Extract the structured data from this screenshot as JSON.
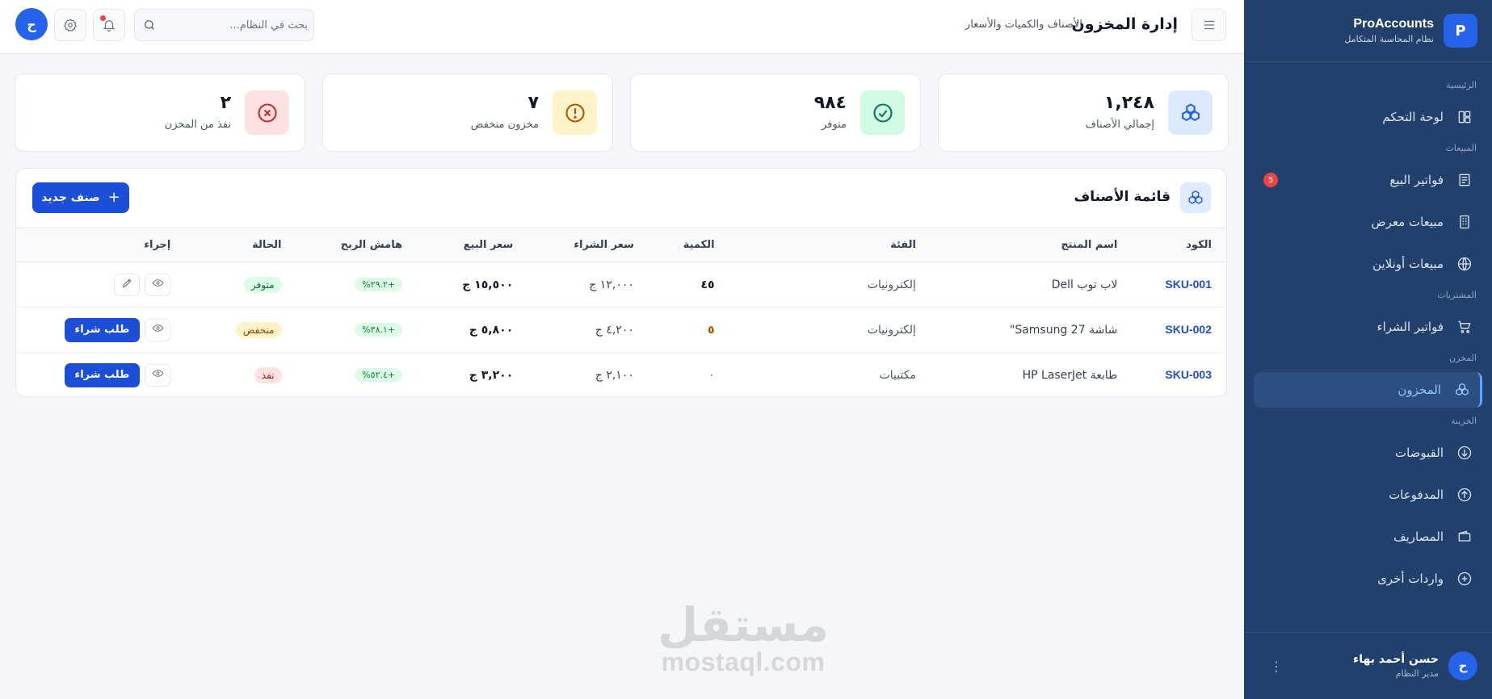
{
  "brand": {
    "logo_letter": "P",
    "name": "ProAccounts",
    "tagline": "نظام المحاسبة المتكامل"
  },
  "sidebar": {
    "sections": [
      {
        "title": "الرئيسية",
        "items": [
          {
            "label": "لوحة التحكم",
            "icon": "dashboard-icon"
          }
        ]
      },
      {
        "title": "المبيعات",
        "items": [
          {
            "label": "فواتير البيع",
            "icon": "receipt-icon",
            "badge": "5"
          },
          {
            "label": "مبيعات معرض",
            "icon": "building-icon"
          },
          {
            "label": "مبيعات أونلاين",
            "icon": "globe-icon"
          }
        ]
      },
      {
        "title": "المشتريات",
        "items": [
          {
            "label": "فواتير الشراء",
            "icon": "cart-icon"
          }
        ]
      },
      {
        "title": "المخزن",
        "items": [
          {
            "label": "المخزون",
            "icon": "boxes-icon",
            "active": true
          }
        ]
      },
      {
        "title": "الخزينة",
        "items": [
          {
            "label": "القبوضات",
            "icon": "arrow-down-circle-icon"
          },
          {
            "label": "المدفوعات",
            "icon": "arrow-up-circle-icon"
          },
          {
            "label": "المصاريف",
            "icon": "wallet-icon"
          },
          {
            "label": "واردات أخرى",
            "icon": "plus-circle-icon"
          }
        ]
      }
    ]
  },
  "user": {
    "avatar_letter": "ح",
    "name": "حسن أحمد بهاء",
    "role": "مدير النظام",
    "menu_glyph": "⋮"
  },
  "header": {
    "title": "إدارة المخزون",
    "subtitle": "الأصناف والكميات والأسعار",
    "search_placeholder": "بحث في النظام...",
    "avatar_letter": "ح"
  },
  "stats": [
    {
      "value": "١,٢٤٨",
      "label": "إجمالي الأصناف",
      "icon": "boxes-icon",
      "bg": "#dbeafe",
      "fg": "#2563eb"
    },
    {
      "value": "٩٨٤",
      "label": "متوفر",
      "icon": "check-circle-icon",
      "bg": "#d1fae5",
      "fg": "#047857"
    },
    {
      "value": "٧",
      "label": "مخزون منخفض",
      "icon": "alert-circle-icon",
      "bg": "#fef3c7",
      "fg": "#b45309"
    },
    {
      "value": "٢",
      "label": "نفذ من المخزن",
      "icon": "x-circle-icon",
      "bg": "#fee2e2",
      "fg": "#dc2626"
    }
  ],
  "items_table": {
    "title": "قائمة الأصناف",
    "add_button": "صنف جديد",
    "columns": [
      "الكود",
      "اسم المنتج",
      "الفئة",
      "الكمية",
      "سعر الشراء",
      "سعر البيع",
      "هامش الربح",
      "الحالة",
      "إجراء"
    ],
    "rows": [
      {
        "sku": "SKU-001",
        "name": "لاب توب Dell",
        "category": "إلكترونيات",
        "qty": "٤٥",
        "qty_state": "ok",
        "buy": "١٢,٠٠٠ ج",
        "sell": "١٥,٥٠٠ ج",
        "margin": "+٢٩.٢%",
        "status": "متوفر",
        "status_type": "ok",
        "actions": [
          "view",
          "edit"
        ]
      },
      {
        "sku": "SKU-002",
        "name": "شاشة Samsung 27\"",
        "category": "إلكترونيات",
        "qty": "٥",
        "qty_state": "low",
        "buy": "٤,٢٠٠ ج",
        "sell": "٥,٨٠٠ ج",
        "margin": "+٣٨.١%",
        "status": "منخفض",
        "status_type": "low",
        "actions": [
          "view",
          "order"
        ],
        "order_label": "طلب شراء"
      },
      {
        "sku": "SKU-003",
        "name": "طابعة HP LaserJet",
        "category": "مكتبيات",
        "qty": "٠",
        "qty_state": "zero",
        "buy": "٢,١٠٠ ج",
        "sell": "٣,٢٠٠ ج",
        "margin": "+٥٢.٤%",
        "status": "نفذ",
        "status_type": "out",
        "actions": [
          "view",
          "order"
        ],
        "order_label": "طلب شراء"
      }
    ]
  },
  "watermark": {
    "arabic": "مستقل",
    "latin": "mostaql.com"
  }
}
